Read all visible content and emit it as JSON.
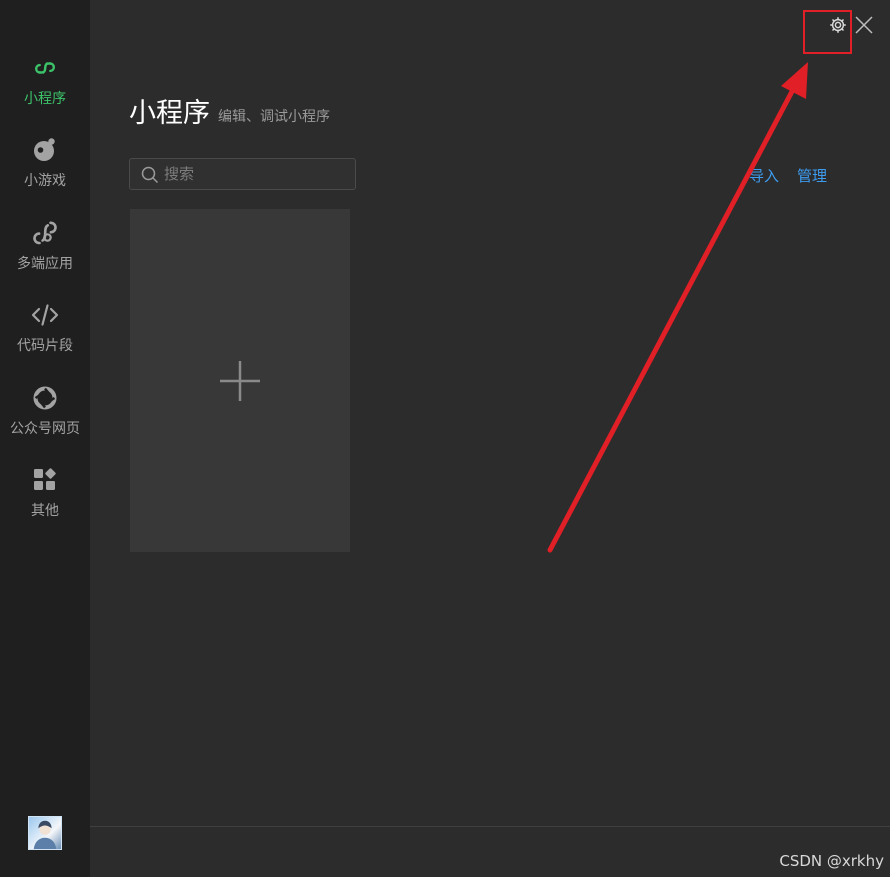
{
  "sidebar": {
    "items": [
      {
        "label": "小程序",
        "icon": "mini-program-icon",
        "active": true
      },
      {
        "label": "小游戏",
        "icon": "mini-game-icon",
        "active": false
      },
      {
        "label": "多端应用",
        "icon": "multi-platform-icon",
        "active": false
      },
      {
        "label": "代码片段",
        "icon": "code-snippet-icon",
        "active": false
      },
      {
        "label": "公众号网页",
        "icon": "official-account-web-icon",
        "active": false
      },
      {
        "label": "其他",
        "icon": "others-icon",
        "active": false
      }
    ],
    "avatar": "user-avatar"
  },
  "header": {
    "title": "小程序",
    "subtitle": "编辑、调试小程序"
  },
  "search": {
    "placeholder": "搜索",
    "value": ""
  },
  "actions": {
    "import_label": "导入",
    "manage_label": "管理"
  },
  "new_project_card": {
    "icon": "plus-icon"
  },
  "window_controls": {
    "settings_icon": "gear-icon",
    "close_icon": "close-icon"
  },
  "watermark": "CSDN @xrkhy",
  "colors": {
    "sidebar_bg": "#1f1f1f",
    "main_bg": "#2c2c2c",
    "accent_green": "#3cc36a",
    "link_blue": "#3d9cf0",
    "annotation_red": "#e01f26"
  }
}
